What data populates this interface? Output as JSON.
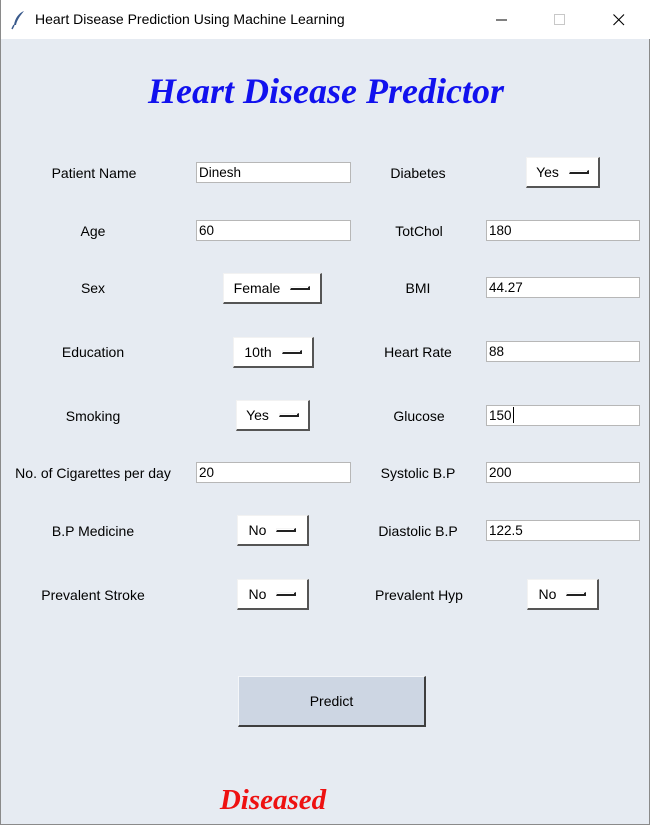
{
  "window": {
    "title": "Heart Disease Prediction Using Machine Learning",
    "icons": {
      "app": "feather-icon",
      "minimize": "minimize-icon",
      "maximize": "maximize-icon",
      "close": "close-icon"
    }
  },
  "heading": "Heart Disease Predictor",
  "form": {
    "patient_name": {
      "label": "Patient Name",
      "value": "Dinesh"
    },
    "age": {
      "label": "Age",
      "value": "60"
    },
    "sex": {
      "label": "Sex",
      "value": "Female"
    },
    "education": {
      "label": "Education",
      "value": "10th"
    },
    "smoking": {
      "label": "Smoking",
      "value": "Yes"
    },
    "cigs_per_day": {
      "label": "No. of Cigarettes per day",
      "value": "20"
    },
    "bp_medicine": {
      "label": "B.P Medicine",
      "value": "No"
    },
    "prevalent_stroke": {
      "label": "Prevalent Stroke",
      "value": "No"
    },
    "diabetes": {
      "label": "Diabetes",
      "value": "Yes"
    },
    "tot_chol": {
      "label": "TotChol",
      "value": "180"
    },
    "bmi": {
      "label": "BMI",
      "value": "44.27"
    },
    "heart_rate": {
      "label": "Heart Rate",
      "value": "88"
    },
    "glucose": {
      "label": "Glucose",
      "value": "150"
    },
    "systolic_bp": {
      "label": "Systolic B.P",
      "value": "200"
    },
    "diastolic_bp": {
      "label": "Diastolic B.P",
      "value": "122.5"
    },
    "prevalent_hyp": {
      "label": "Prevalent Hyp",
      "value": "No"
    }
  },
  "predict_label": "Predict",
  "result": "Diseased",
  "colors": {
    "heading": "#1111ee",
    "result": "#ee1111",
    "background": "#e6ebf2",
    "button": "#cdd6e3"
  }
}
